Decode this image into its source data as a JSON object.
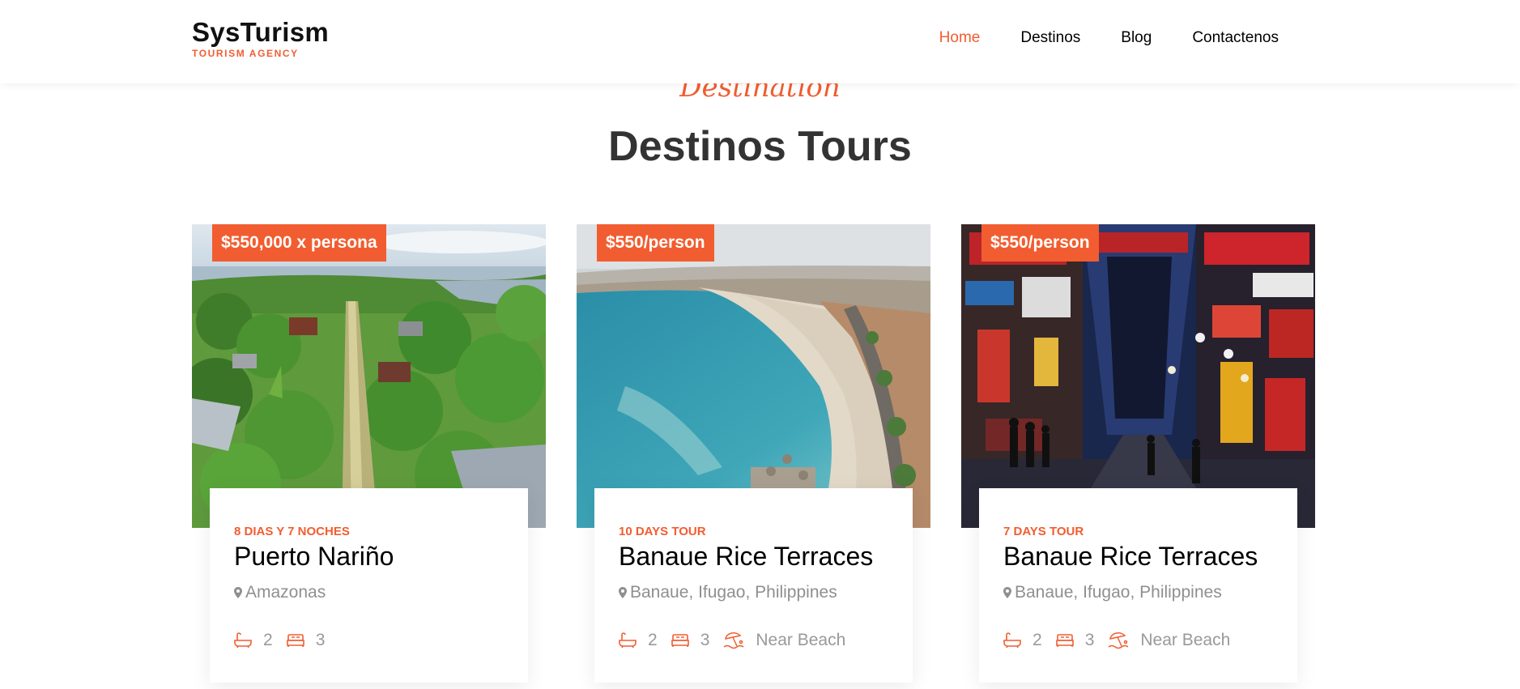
{
  "brand": {
    "name": "SysTurism",
    "tagline": "TOURISM AGENCY"
  },
  "nav": {
    "items": [
      "Home",
      "Destinos",
      "Blog",
      "Contactenos"
    ],
    "active": "Home"
  },
  "section": {
    "subheading": "Destination",
    "heading": "Destinos Tours"
  },
  "colors": {
    "accent": "#f15d30",
    "heading": "#333333",
    "muted": "#8f8f8f"
  },
  "cards": [
    {
      "price": "$550,000 x persona",
      "duration": "8 DIAS Y 7 NOCHES",
      "title": "Puerto Nariño",
      "location": "Amazonas",
      "baths": "2",
      "beds": "3",
      "beach": "",
      "image": "aerial-village-amazon-river"
    },
    {
      "price": "$550/person",
      "duration": "10 DAYS TOUR",
      "title": "Banaue Rice Terraces",
      "location": "Banaue, Ifugao, Philippines",
      "baths": "2",
      "beds": "3",
      "beach": "Near Beach",
      "image": "coastal-beach-city"
    },
    {
      "price": "$550/person",
      "duration": "7 DAYS TOUR",
      "title": "Banaue Rice Terraces",
      "location": "Banaue, Ifugao, Philippines",
      "baths": "2",
      "beds": "3",
      "beach": "Near Beach",
      "image": "neon-city-street-night"
    }
  ]
}
